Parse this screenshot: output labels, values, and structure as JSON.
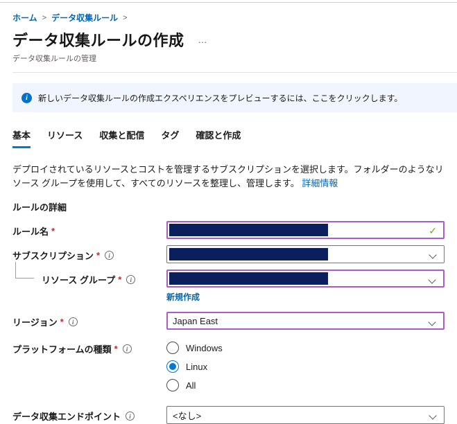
{
  "breadcrumb": {
    "items": [
      {
        "label": "ホーム"
      },
      {
        "label": "データ収集ルール"
      }
    ],
    "separator": ">"
  },
  "header": {
    "title": "データ収集ルールの作成",
    "more_label": "…",
    "subtitle": "データ収集ルールの管理"
  },
  "banner": {
    "icon": "info-icon",
    "icon_glyph": "i",
    "text": "新しいデータ収集ルールの作成エクスペリエンスをプレビューするには、ここをクリックします。",
    "background": "#f0f5ff",
    "icon_color": "#0072c9"
  },
  "tabs": [
    {
      "label": "基本",
      "active": true
    },
    {
      "label": "リソース",
      "active": false
    },
    {
      "label": "収集と配信",
      "active": false
    },
    {
      "label": "タグ",
      "active": false
    },
    {
      "label": "確認と作成",
      "active": false
    }
  ],
  "description": {
    "text": "デプロイされているリソースとコストを管理するサブスクリプションを選択します。フォルダーのようなリソース グループを使用して、すべてのリソースを整理し、管理します。",
    "link_label": "詳細情報"
  },
  "section": {
    "title": "ルールの詳細"
  },
  "ui": {
    "required_mark": "*",
    "info_glyph": "i",
    "check_glyph": "✓"
  },
  "form": {
    "rule_name": {
      "label": "ルール名",
      "required": true,
      "value_redacted": true,
      "valid": true
    },
    "subscription": {
      "label": "サブスクリプション",
      "required": true,
      "has_info": true,
      "value_redacted": true
    },
    "resource_group": {
      "label": "リソース グループ",
      "required": true,
      "has_info": true,
      "value_redacted": true,
      "create_new_label": "新規作成"
    },
    "region": {
      "label": "リージョン",
      "required": true,
      "has_info": true,
      "value": "Japan East"
    },
    "platform_type": {
      "label": "プラットフォームの種類",
      "required": true,
      "has_info": true,
      "options": [
        {
          "label": "Windows",
          "selected": false
        },
        {
          "label": "Linux",
          "selected": true
        },
        {
          "label": "All",
          "selected": false
        }
      ]
    },
    "data_collection_endpoint": {
      "label": "データ収集エンドポイント",
      "has_info": true,
      "value": "<なし>"
    }
  },
  "colors": {
    "accent_blue": "#0078d4",
    "link_blue": "#0067b8",
    "redaction_navy": "#0b1f5c",
    "purple_border": "#a95cc5",
    "valid_green": "#5db300",
    "required_red": "#c02b2b",
    "banner_bg": "#f0f5ff"
  }
}
